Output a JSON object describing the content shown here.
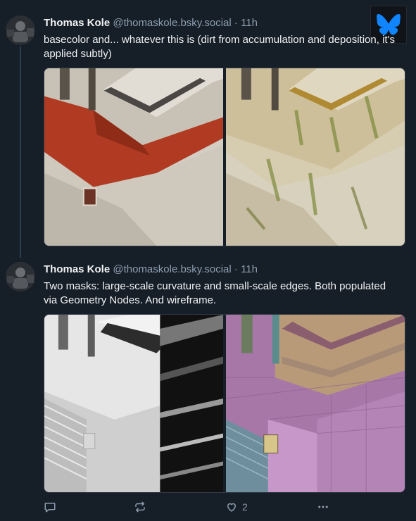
{
  "posts": [
    {
      "author": "Thomas Kole",
      "handle": "@thomaskole.bsky.social",
      "separator": "·",
      "time": "11h",
      "text": "basecolor and... whatever this is (dirt from accumulation and deposition, it's applied subtly)",
      "images": [
        "basecolor-render",
        "dirt-mask-render"
      ]
    },
    {
      "author": "Thomas Kole",
      "handle": "@thomaskole.bsky.social",
      "separator": "·",
      "time": "11h",
      "text": "Two masks: large-scale curvature and small-scale edges. Both populated via Geometry Nodes. And wireframe.",
      "images": [
        "curvature-edges-mask-render",
        "wireframe-render"
      ],
      "actions": {
        "reply_icon": "reply-icon",
        "repost_icon": "repost-icon",
        "like_icon": "heart-icon",
        "like_count": "2",
        "more_icon": "more-icon"
      }
    }
  ],
  "badge": {
    "icon": "bluesky-butterfly-icon",
    "color": "#1185fe"
  }
}
